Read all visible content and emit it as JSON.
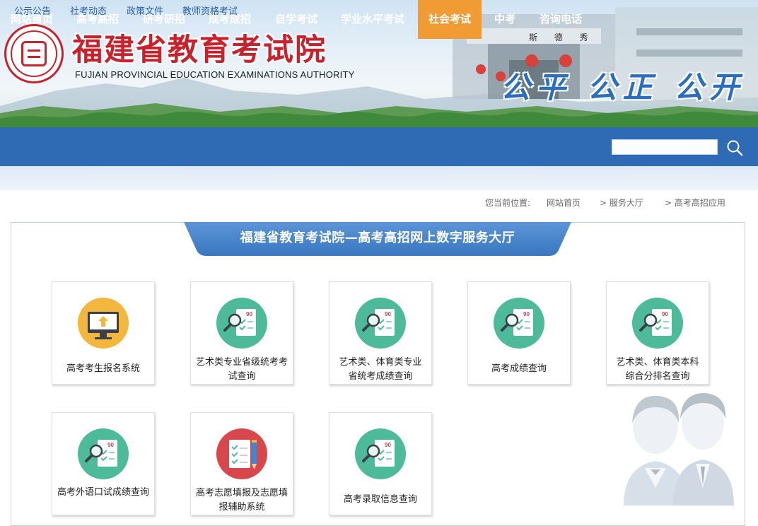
{
  "header": {
    "title_cn": "福建省教育考试院",
    "title_en": "FUJIAN PROVINCIAL EDUCATION EXAMINATIONS AUTHORITY",
    "motto": "公平 公正 公开",
    "gate_plaque": "斯 德 秀",
    "seal_icon": "institution-seal-icon"
  },
  "nav": {
    "items": [
      {
        "label": "网站首页"
      },
      {
        "label": "高考高招"
      },
      {
        "label": "研考研招"
      },
      {
        "label": "成考成招"
      },
      {
        "label": "自学考试"
      },
      {
        "label": "学业水平考试"
      },
      {
        "label": "社会考试"
      },
      {
        "label": "中考"
      },
      {
        "label": "咨询电话"
      }
    ],
    "active_index": 6,
    "active_color": "#f19b34",
    "bar_color": "#2f6ab5",
    "search_value": "",
    "search_icon": "search-icon"
  },
  "subnav": {
    "items": [
      {
        "label": "公示公告"
      },
      {
        "label": "社考动态"
      },
      {
        "label": "政策文件"
      },
      {
        "label": "教师资格考试"
      }
    ]
  },
  "breadcrumb": {
    "prefix": "您当前位置:",
    "items": [
      "网站首页",
      "> 服务大厅",
      "> 高考高招应用"
    ]
  },
  "hall": {
    "title": "福建省教育考试院—高考高招网上数字服务大厅",
    "cards": [
      {
        "lines": [
          "高考考生报名系统"
        ],
        "icon": "monitor-upload-icon"
      },
      {
        "lines": [
          "艺术类专业省级统考考",
          "试查询"
        ],
        "icon": "score-search-icon"
      },
      {
        "lines": [
          "艺术类、体育类专业",
          "省统考成绩查询"
        ],
        "icon": "score-search-icon"
      },
      {
        "lines": [
          "高考成绩查询"
        ],
        "icon": "score-search-icon"
      },
      {
        "lines": [
          "艺术类、体育类本科",
          "综合分排名查询"
        ],
        "icon": "score-search-icon"
      },
      {
        "lines": [
          "高考外语口试成绩查询"
        ],
        "icon": "score-search-icon"
      },
      {
        "lines": [
          "高考志愿填报及志愿填",
          "报辅助系统"
        ],
        "icon": "form-pencil-icon"
      },
      {
        "lines": [
          "高考录取信息查询"
        ],
        "icon": "score-search-icon"
      }
    ],
    "agents_icon": "customer-service-agents-icon"
  }
}
